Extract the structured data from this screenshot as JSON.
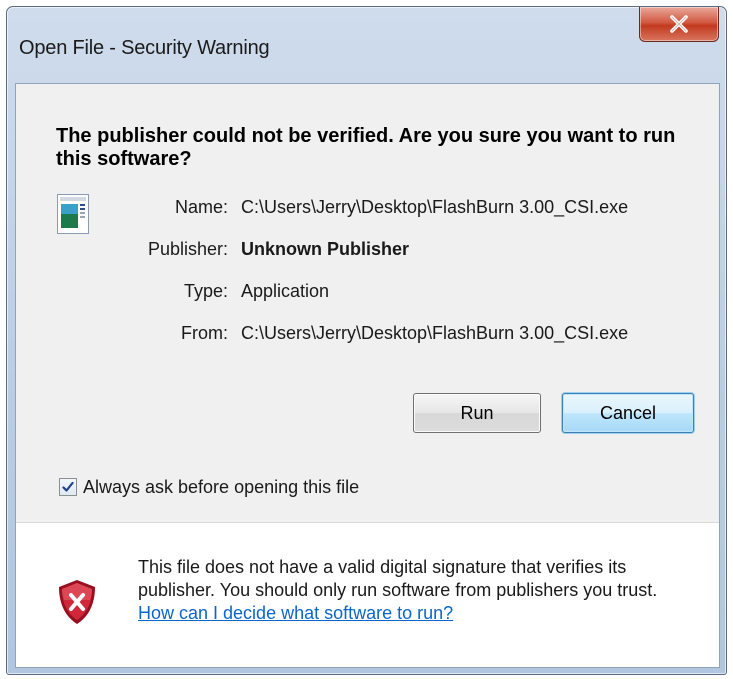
{
  "window": {
    "title": "Open File - Security Warning",
    "close_glyph": "X"
  },
  "heading": "The publisher could not be verified.  Are you sure you want to run this software?",
  "details": {
    "name_label": "Name:",
    "name_value": "C:\\Users\\Jerry\\Desktop\\FlashBurn 3.00_CSI.exe",
    "publisher_label": "Publisher:",
    "publisher_value": "Unknown Publisher",
    "type_label": "Type:",
    "type_value": "Application",
    "from_label": "From:",
    "from_value": "C:\\Users\\Jerry\\Desktop\\FlashBurn 3.00_CSI.exe"
  },
  "buttons": {
    "run": "Run",
    "cancel": "Cancel"
  },
  "checkbox": {
    "label": "Always ask before opening this file",
    "checked": true
  },
  "warning": {
    "text": "This file does not have a valid digital signature that verifies its publisher.  You should only run software from publishers you trust.",
    "link": "How can I decide what software to run?"
  },
  "icons": {
    "app": "application-icon",
    "shield": "security-shield-icon",
    "close": "close-icon",
    "check": "checkmark-icon"
  },
  "colors": {
    "link": "#0a66cc",
    "shield_red": "#c8102e",
    "close_button": "#c23a1f",
    "cancel_focus_border": "#3c7fb1"
  }
}
